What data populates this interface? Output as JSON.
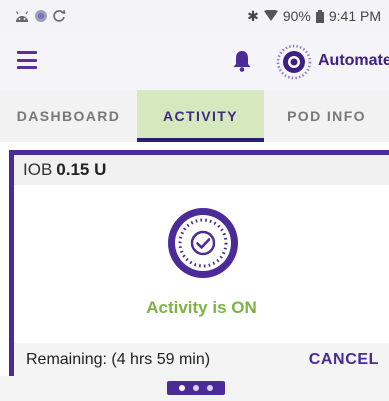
{
  "status_bar": {
    "icons_left": [
      "android-icon",
      "notification-dot-icon",
      "sync-icon"
    ],
    "icons_right": [
      "bluetooth-icon",
      "wifi-icon"
    ],
    "battery_text": "90%",
    "time": "9:41 PM"
  },
  "app_bar": {
    "menu_icon": "hamburger-menu-icon",
    "bell_icon": "bell-icon",
    "mode_label": "Automated"
  },
  "tabs": [
    {
      "label": "DASHBOARD",
      "selected": false
    },
    {
      "label": "ACTIVITY",
      "selected": true
    },
    {
      "label": "POD INFO",
      "selected": false
    }
  ],
  "activity_card": {
    "iob_label": "IOB",
    "iob_value": "0.15 U",
    "status_text": "Activity is ON",
    "remaining_text": "Remaining: (4 hrs 59 min)",
    "cancel_label": "CANCEL"
  },
  "pager": {
    "count": 3,
    "active_index": 0
  },
  "colors": {
    "primary": "#4b2b97",
    "tab_selected_bg": "#d6e8be",
    "status_green": "#7cb342"
  }
}
